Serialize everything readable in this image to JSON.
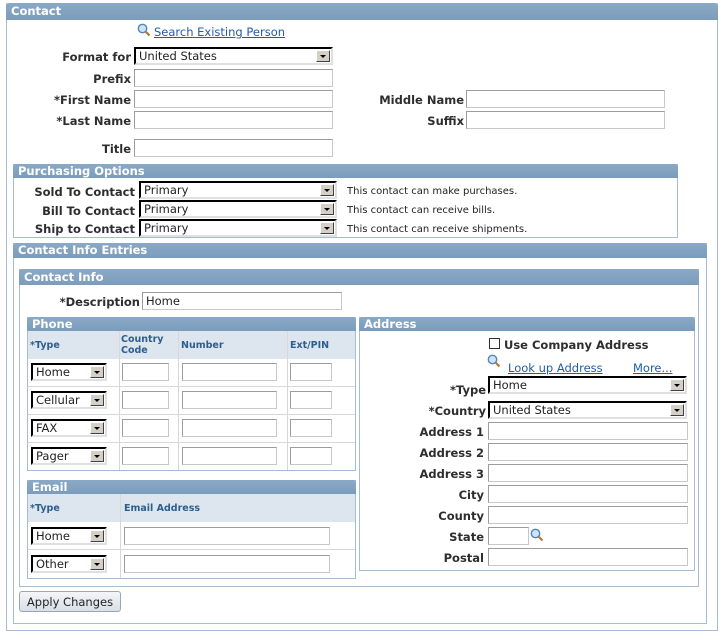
{
  "contact": {
    "title": "Contact",
    "search_link": "Search Existing Person",
    "format_for_label": "Format for",
    "format_for_value": "United States",
    "prefix_label": "Prefix",
    "first_name_label": "*First Name",
    "last_name_label": "*Last Name",
    "title_label": "Title",
    "middle_name_label": "Middle Name",
    "suffix_label": "Suffix"
  },
  "purchasing": {
    "title": "Purchasing Options",
    "rows": [
      {
        "label": "Sold To Contact",
        "value": "Primary",
        "note": "This contact can make purchases."
      },
      {
        "label": "Bill To Contact",
        "value": "Primary",
        "note": "This contact can receive bills."
      },
      {
        "label": "Ship to Contact",
        "value": "Primary",
        "note": "This contact can receive shipments."
      }
    ]
  },
  "entries": {
    "title": "Contact Info Entries",
    "contact_info_title": "Contact Info",
    "description_label": "*Description",
    "description_value": "Home"
  },
  "phone": {
    "title": "Phone",
    "columns": [
      "*Type",
      "Country Code",
      "Number",
      "Ext/PIN"
    ],
    "rows": [
      {
        "type": "Home"
      },
      {
        "type": "Cellular"
      },
      {
        "type": "FAX"
      },
      {
        "type": "Pager"
      }
    ]
  },
  "email": {
    "title": "Email",
    "columns": [
      "*Type",
      "Email Address"
    ],
    "rows": [
      {
        "type": "Home"
      },
      {
        "type": "Other"
      }
    ]
  },
  "address": {
    "title": "Address",
    "use_company_label": "Use Company Address",
    "lookup_link": "Look up Address",
    "more_link": "More...",
    "type_label": "*Type",
    "type_value": "Home",
    "country_label": "*Country",
    "country_value": "United States",
    "fields": [
      "Address 1",
      "Address 2",
      "Address 3",
      "City",
      "County"
    ],
    "state_label": "State",
    "postal_label": "Postal"
  },
  "apply_button": "Apply Changes"
}
